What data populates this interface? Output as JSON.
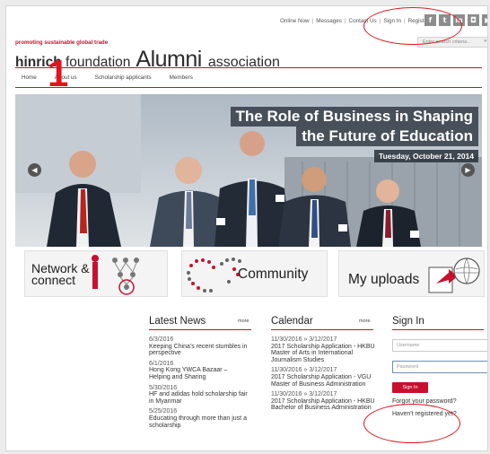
{
  "top_links": [
    "Online Now",
    "Messages",
    "Contact Us",
    "Sign In",
    "Register"
  ],
  "social_icons": [
    "facebook-icon",
    "twitter-icon",
    "linkedin-icon",
    "flickr-icon",
    "youtube-icon"
  ],
  "search": {
    "placeholder": "Enter search criteria..."
  },
  "logo": {
    "tagline": "promoting sustainable global trade",
    "foundation_a": "hinrich",
    "foundation_b": " foundation",
    "alumni": "Alumni",
    "association": "association"
  },
  "nav": [
    "Home",
    "About us",
    "Scholarship applicants",
    "Members"
  ],
  "annotation_number": "1",
  "hero": {
    "line1": "The Role of Business in Shaping",
    "line2": "the Future of Education",
    "date": "Tuesday, October 21, 2014"
  },
  "tiles": {
    "network": "Network &",
    "network2": "connect",
    "community": "Community",
    "uploads": "My uploads"
  },
  "news": {
    "title": "Latest News",
    "more": "more",
    "items": [
      {
        "date": "6/3/2016",
        "title": "Keeping China's recent stumbles in perspective"
      },
      {
        "date": "6/1/2016",
        "title": "Hong Kong YWCA Bazaar – Helping and Sharing"
      },
      {
        "date": "5/30/2016",
        "title": "HF and adidas hold scholarship fair in Myanmar"
      },
      {
        "date": "5/25/2016",
        "title": "Educating through more than just a scholarship"
      }
    ]
  },
  "calendar": {
    "title": "Calendar",
    "more": "more",
    "items": [
      {
        "date": "11/30/2016 » 3/12/2017",
        "title": "2017 Scholarship Application - HKBU Master of Arts in International Journalism Studies"
      },
      {
        "date": "11/30/2016 » 3/12/2017",
        "title": "2017 Scholarship Application - VGU Master of Business Administration"
      },
      {
        "date": "11/30/2016 » 3/12/2017",
        "title": "2017 Scholarship Application - HKBU Bachelor of Business Administration"
      }
    ]
  },
  "signin": {
    "title": "Sign In",
    "username_placeholder": "Username",
    "password_placeholder": "Password",
    "button": "Sign In",
    "forgot": "Forgot your password?",
    "register": "Haven't registered yet?"
  },
  "colors": {
    "accent": "#c8102e",
    "annotation": "#e3131b"
  }
}
